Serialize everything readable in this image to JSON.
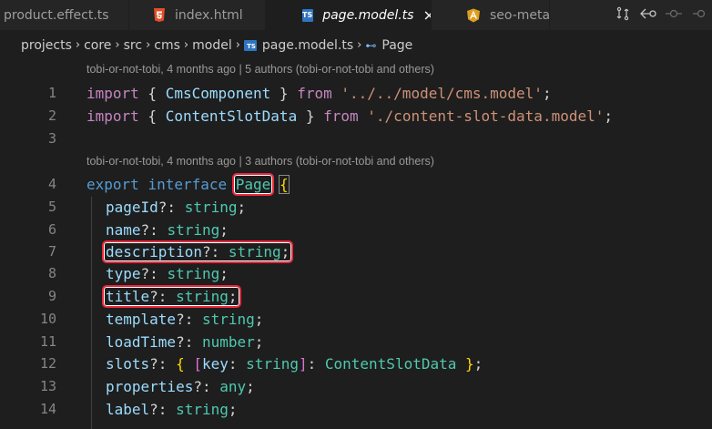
{
  "tabs": [
    {
      "label": "product.effect.ts",
      "icon": "typescript-icon"
    },
    {
      "label": "index.html",
      "icon": "html-icon"
    },
    {
      "label": "page.model.ts",
      "icon": "typescript-icon",
      "active": true,
      "close": "×"
    },
    {
      "label": "seo-meta.s",
      "icon": "angular-icon"
    }
  ],
  "ts_badge": "TS",
  "actions": {
    "compare": "⇆",
    "back": "⟲",
    "dot1": "-○-",
    "dot2": "-○"
  },
  "breadcrumb": {
    "items": [
      "projects",
      "core",
      "src",
      "cms",
      "model",
      "page.model.ts",
      "Page"
    ],
    "separator": "›",
    "symbol_icon": "⊷"
  },
  "codelens": [
    "tobi-or-not-tobi, 4 months ago | 5 authors (tobi-or-not-tobi and others)",
    "tobi-or-not-tobi, 4 months ago | 3 authors (tobi-or-not-tobi and others)"
  ],
  "line_numbers": [
    "1",
    "2",
    "3",
    "4",
    "5",
    "6",
    "7",
    "8",
    "9",
    "10",
    "11",
    "12",
    "13",
    "14"
  ],
  "code": {
    "l1": {
      "kw": "import",
      "o": " { ",
      "name": "CmsComponent",
      "c": " } ",
      "from": "from",
      "str": "'../../model/cms.model'",
      "semi": ";"
    },
    "l2": {
      "kw": "import",
      "o": " { ",
      "name": "ContentSlotData",
      "c": " } ",
      "from": "from",
      "str": "'./content-slot-data.model'",
      "semi": ";"
    },
    "l4": {
      "export": "export",
      "interface": "interface",
      "name": "Page",
      "brace": "{"
    },
    "props": [
      {
        "name": "pageId",
        "type": "string"
      },
      {
        "name": "name",
        "type": "string"
      },
      {
        "name": "description",
        "type": "string"
      },
      {
        "name": "type",
        "type": "string"
      },
      {
        "name": "title",
        "type": "string"
      },
      {
        "name": "template",
        "type": "string"
      },
      {
        "name": "loadTime",
        "type": "number"
      },
      {
        "name": "slots",
        "type": "ContentSlotData"
      },
      {
        "name": "properties",
        "type": "any"
      },
      {
        "name": "label",
        "type": "string"
      }
    ],
    "opt": "?: ",
    "semi": ";",
    "slots_key": "key",
    "slots_key_type": "string"
  },
  "colors": {
    "highlight": "#e8283c",
    "keyword": "#569cd6",
    "string": "#ce9178",
    "type": "#4ec9b0",
    "property": "#9cdcfe"
  }
}
